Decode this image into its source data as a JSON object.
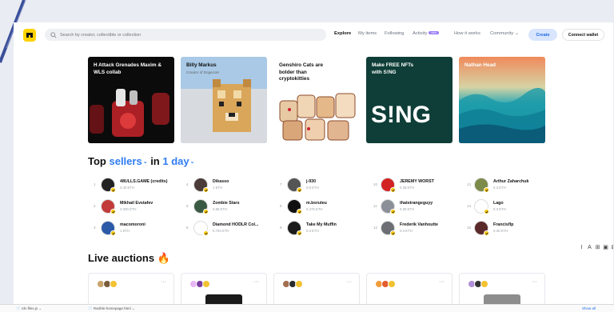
{
  "header": {
    "search_placeholder": "Search by creator, collectible or collection",
    "nav": [
      "Explore",
      "My items",
      "Following",
      "Activity",
      "How it works",
      "Community"
    ],
    "activity_badge": "new",
    "community_chevron": "chevron-down-icon",
    "create_label": "Create",
    "wallet_label": "Connect wallet"
  },
  "featured": [
    {
      "title": "H Attack Grenades Maxim & WLS collab",
      "subtitle": "",
      "bg": "#0d0d0d",
      "text_color": "#ffffff"
    },
    {
      "title": "Billy Markus",
      "subtitle": "Creator of Dogecoin",
      "bg": "#a9c9e6",
      "text_color": "#111111"
    },
    {
      "title": "Genshiro Cats are bolder than cryptokitties",
      "subtitle": "",
      "bg": "#ffffff",
      "text_color": "#111111"
    },
    {
      "title": "Make FREE NFTs with S!NG",
      "subtitle": "",
      "bg": "#0f3e38",
      "text_color": "#ffffff"
    },
    {
      "title": "Nathan Head",
      "subtitle": "",
      "bg": "#e8805a",
      "text_color": "#ffffff"
    }
  ],
  "top_sellers": {
    "prefix": "Top",
    "sellers_word": "sellers",
    "in_word": "in",
    "period": "1 day",
    "items": [
      {
        "rank": "1",
        "name": "48ULLS.GAME (credits)",
        "eth": "3.40 ETH",
        "color": "#222222"
      },
      {
        "rank": "2",
        "name": "Mikhail Evstafev",
        "eth": "2.000 ETH",
        "color": "#c23a3a"
      },
      {
        "rank": "3",
        "name": "macomoroni",
        "eth": "1 ETH",
        "color": "#2a5aa8"
      },
      {
        "rank": "4",
        "name": "Dikasso",
        "eth": "1 ETH",
        "color": "#4a3b38"
      },
      {
        "rank": "5",
        "name": "Zombie Stars",
        "eth": "0.86 ETH",
        "color": "#3b5a44"
      },
      {
        "rank": "6",
        "name": "Diamond HODLR Col...",
        "eth": "0.764 ETH",
        "color": "#ffffff"
      },
      {
        "rank": "7",
        "name": "j-930",
        "eth": "0.5 ETH",
        "color": "#555555"
      },
      {
        "rank": "8",
        "name": "m.boruteu",
        "eth": "0.475 ETH",
        "color": "#111111"
      },
      {
        "rank": "9",
        "name": "Take My Muffin",
        "eth": "0.3 ETH",
        "color": "#1b1b1b"
      },
      {
        "rank": "10",
        "name": "JEREMY WORST",
        "eth": "0.38 ETH",
        "color": "#d32222"
      },
      {
        "rank": "11",
        "name": "thatstrangeguyy",
        "eth": "0.35 ETH",
        "color": "#8a8f98"
      },
      {
        "rank": "12",
        "name": "Frederik Vanhoutte",
        "eth": "0.3 ETH",
        "color": "#6b6f74"
      },
      {
        "rank": "13",
        "name": "Arthur Zaharchuk",
        "eth": "0.3 ETH",
        "color": "#7c8a4a"
      },
      {
        "rank": "14",
        "name": "Lago",
        "eth": "0.3 ETH",
        "color": "#ffffff"
      },
      {
        "rank": "15",
        "name": "Francisflp",
        "eth": "0.30 ETH",
        "color": "#5a2a2a"
      }
    ]
  },
  "live_auctions": {
    "title": "Live auctions",
    "icon": "fire-icon",
    "cards": [
      {
        "avatars": [
          "#c8a36a",
          "#7a5b3b",
          "#f2c230"
        ],
        "preview": "#ffffff"
      },
      {
        "avatars": [
          "#e7b6f5",
          "#7d3fa0",
          "#f2c230"
        ],
        "preview": "#1a1a1a"
      },
      {
        "avatars": [
          "#a36f4e",
          "#2b2b2b",
          "#f2c230"
        ],
        "preview": "#ffffff"
      },
      {
        "avatars": [
          "#f29b3b",
          "#e35b2f",
          "#f2c230"
        ],
        "preview": "#ffffff"
      },
      {
        "avatars": [
          "#b08fd8",
          "#333333",
          "#f2c230"
        ],
        "preview": "#8d8d8d"
      }
    ]
  },
  "floating_toolbar": [
    "I",
    "A",
    "⊞",
    "▣",
    "⊠",
    "⊡"
  ],
  "taskbar": [
    "rdc-files.js",
    "Rarible-homepage.html",
    "Show all"
  ]
}
